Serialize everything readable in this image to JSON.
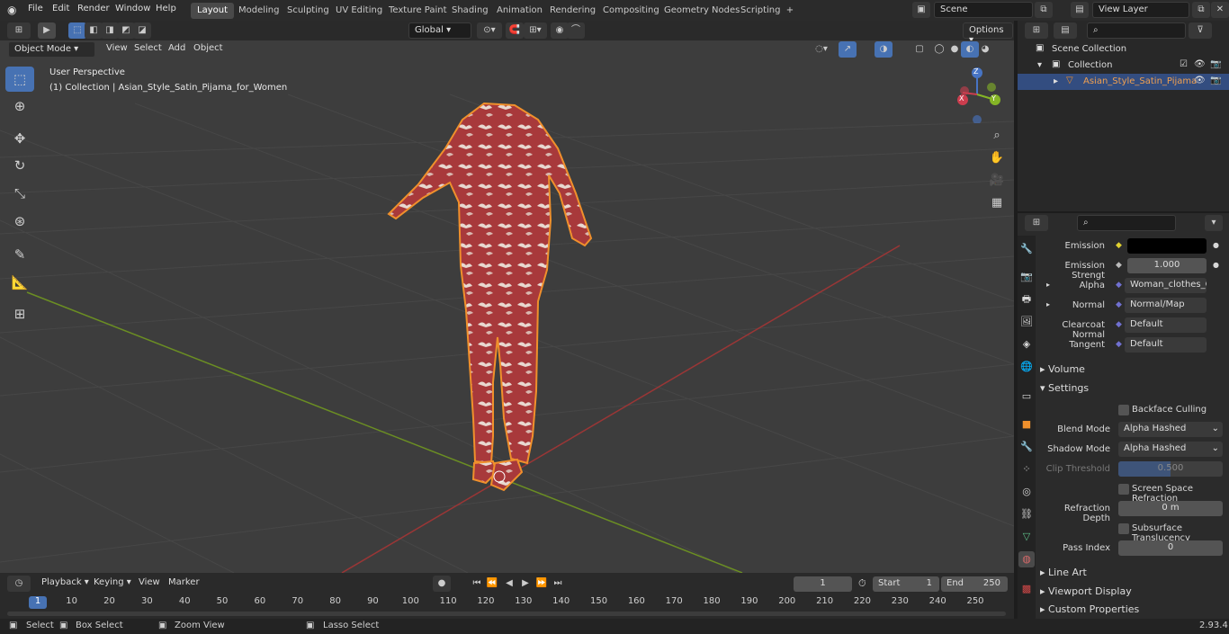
{
  "menu": {
    "file": "File",
    "edit": "Edit",
    "render": "Render",
    "window": "Window",
    "help": "Help"
  },
  "workspaces": [
    "Layout",
    "Modeling",
    "Sculpting",
    "UV Editing",
    "Texture Paint",
    "Shading",
    "Animation",
    "Rendering",
    "Compositing",
    "Geometry Nodes",
    "Scripting"
  ],
  "scene": "Scene",
  "view_layer": "View Layer",
  "header": {
    "mode": "Object Mode",
    "view": "View",
    "select": "Select",
    "add": "Add",
    "object": "Object",
    "orientation": "Global",
    "options": "Options"
  },
  "viewport": {
    "perspective": "User Perspective",
    "collection_label": "(1) Collection | Asian_Style_Satin_Pijama_for_Women"
  },
  "gizmo": {
    "x": "X",
    "y": "Y",
    "z": "Z"
  },
  "outliner": {
    "scene_collection": "Scene Collection",
    "collection": "Collection",
    "object": "Asian_Style_Satin_Pijama"
  },
  "props": {
    "emission_label": "Emission",
    "emission_strength_label": "Emission Strengt",
    "emission_strength": "1.000",
    "alpha_label": "Alpha",
    "alpha": "Woman_clothes_Op...",
    "normal_label": "Normal",
    "normal": "Normal/Map",
    "clearcoat_label": "Clearcoat Normal",
    "clearcoat": "Default",
    "tangent_label": "Tangent",
    "tangent": "Default",
    "volume": "Volume",
    "settings": "Settings",
    "backface": "Backface Culling",
    "blend_label": "Blend Mode",
    "blend": "Alpha Hashed",
    "shadow_label": "Shadow Mode",
    "shadow": "Alpha Hashed",
    "clip_label": "Clip Threshold",
    "clip": "0.500",
    "clip_fill": 0.5,
    "ssr": "Screen Space Refraction",
    "refraction_label": "Refraction Depth",
    "refraction": "0 m",
    "subsurface": "Subsurface Translucency",
    "pass_label": "Pass Index",
    "pass": "0",
    "line_art": "Line Art",
    "viewport_display": "Viewport Display",
    "custom_props": "Custom Properties"
  },
  "timeline": {
    "playback": "Playback",
    "keying": "Keying",
    "view": "View",
    "marker": "Marker",
    "current": "1",
    "start_label": "Start",
    "start": "1",
    "end_label": "End",
    "end": "250",
    "ticks": [
      "1",
      "10",
      "20",
      "30",
      "40",
      "50",
      "60",
      "70",
      "80",
      "90",
      "100",
      "110",
      "120",
      "130",
      "140",
      "150",
      "160",
      "170",
      "180",
      "190",
      "200",
      "210",
      "220",
      "230",
      "240",
      "250"
    ]
  },
  "status": {
    "select": "Select",
    "box_select": "Box Select",
    "zoom_view": "Zoom View",
    "lasso_select": "Lasso Select",
    "version": "2.93.4"
  }
}
